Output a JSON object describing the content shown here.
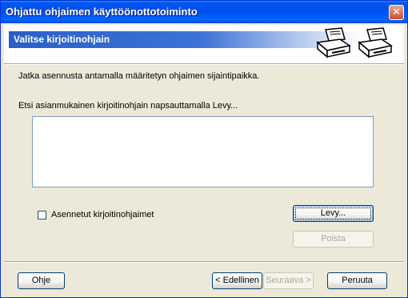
{
  "window": {
    "title": "Ohjattu ohjaimen käyttöönottotoiminto",
    "close_glyph": "✕"
  },
  "header": {
    "title": "Valitse kirjoitinohjain"
  },
  "instructions": {
    "line1": "Jatka asennusta antamalla määritetyn ohjaimen sijaintipaikka.",
    "line2": "Etsi asianmukainen kirjoitinohjain napsauttamalla Levy..."
  },
  "driver_list": {
    "items": []
  },
  "installed_drivers": {
    "label": "Asennetut kirjoitinohjaimet",
    "checked": false
  },
  "buttons": {
    "disk": "Levy...",
    "remove": "Poista",
    "help": "Ohje",
    "back": "< Edellinen",
    "next": "Seuraava >",
    "cancel": "Peruuta"
  },
  "icons": [
    "printer-icon",
    "printer-icon"
  ],
  "colors": {
    "title_bar": "#0054e3",
    "header_accent": "#2a5fc8",
    "face": "#ece9d8"
  }
}
